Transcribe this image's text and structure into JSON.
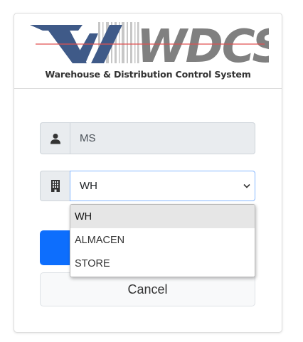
{
  "brand": {
    "logo_text": "WDCS",
    "tagline": "Warehouse & Distribution Control System"
  },
  "form": {
    "user": {
      "icon": "user-icon",
      "value": "MS"
    },
    "location": {
      "icon": "building-icon",
      "selected": "WH",
      "options": [
        "WH",
        "ALMACEN",
        "STORE"
      ]
    },
    "submit_label": "",
    "cancel_label": "Cancel"
  },
  "colors": {
    "primary": "#0d6efd",
    "logo_blue": "#3f5a88",
    "logo_gray": "#808080",
    "logo_red_line": "#e05050"
  }
}
